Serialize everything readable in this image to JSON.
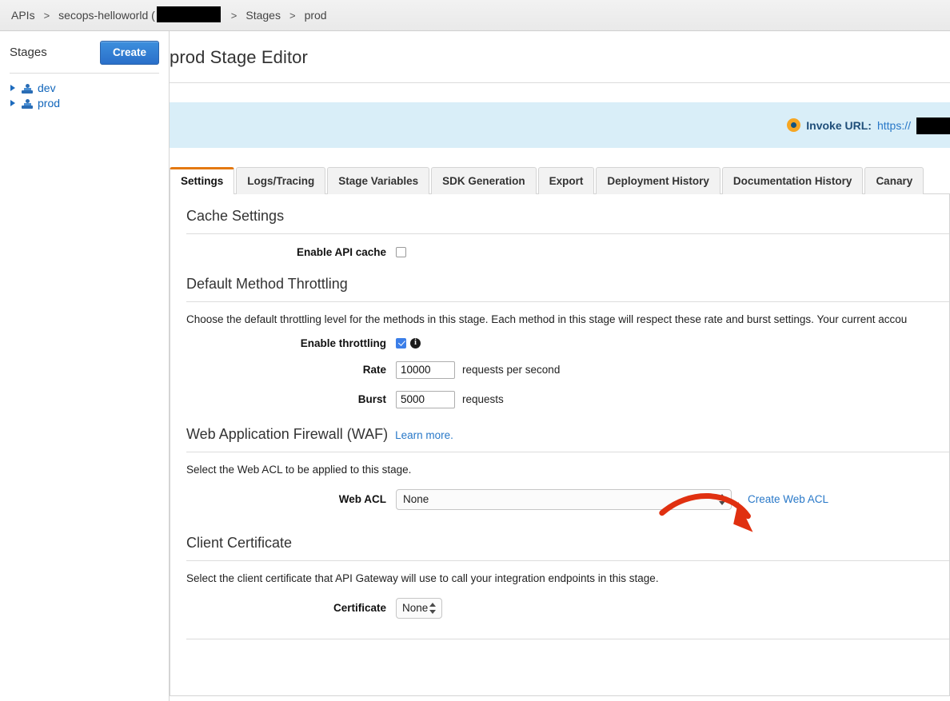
{
  "breadcrumb": {
    "items": [
      {
        "label": "APIs",
        "type": "link"
      },
      {
        "label": "secops-helloworld (",
        "type": "link"
      },
      {
        "label": "Stages",
        "type": "link"
      },
      {
        "label": "prod",
        "type": "text"
      }
    ],
    "separator": ">"
  },
  "sidebar": {
    "title": "Stages",
    "create_label": "Create",
    "items": [
      {
        "label": "dev"
      },
      {
        "label": "prod"
      }
    ]
  },
  "header": {
    "title": "prod Stage Editor"
  },
  "invoke": {
    "label": "Invoke URL:",
    "url": "https://",
    "dot_color": "#f6a623"
  },
  "tabs": [
    {
      "label": "Settings",
      "active": true
    },
    {
      "label": "Logs/Tracing",
      "active": false
    },
    {
      "label": "Stage Variables",
      "active": false
    },
    {
      "label": "SDK Generation",
      "active": false
    },
    {
      "label": "Export",
      "active": false
    },
    {
      "label": "Deployment History",
      "active": false
    },
    {
      "label": "Documentation History",
      "active": false
    },
    {
      "label": "Canary",
      "active": false
    }
  ],
  "cache": {
    "title": "Cache Settings",
    "enable_label": "Enable API cache",
    "enable_checked": false
  },
  "throttling": {
    "title": "Default Method Throttling",
    "description": "Choose the default throttling level for the methods in this stage. Each method in this stage will respect these rate and burst settings. Your current accou",
    "enable_label": "Enable throttling",
    "enable_checked": true,
    "info_glyph": "i",
    "rate_label": "Rate",
    "rate_value": "10000",
    "rate_unit": "requests per second",
    "burst_label": "Burst",
    "burst_value": "5000",
    "burst_unit": "requests"
  },
  "waf": {
    "title": "Web Application Firewall (WAF)",
    "learn_more": "Learn more.",
    "description": "Select the Web ACL to be applied to this stage.",
    "acl_label": "Web ACL",
    "acl_value": "None",
    "create_link": "Create Web ACL",
    "arrow_color": "#e03010"
  },
  "certificate": {
    "title": "Client Certificate",
    "description": "Select the client certificate that API Gateway will use to call your integration endpoints in this stage.",
    "label": "Certificate",
    "value": "None"
  }
}
